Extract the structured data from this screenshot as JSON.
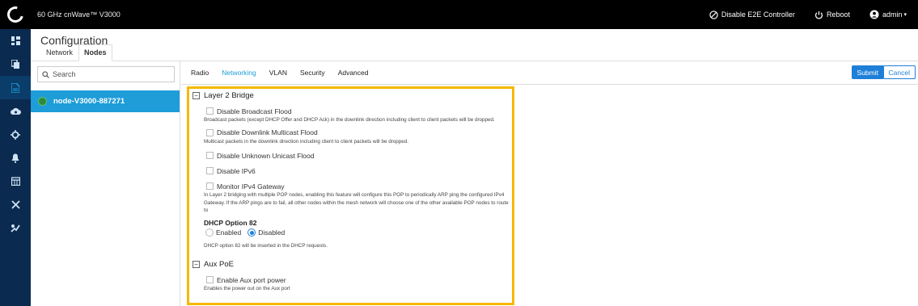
{
  "topbar": {
    "app_title": "60 GHz cnWave™ V3000",
    "disable_e2e": "Disable E2E Controller",
    "reboot": "Reboot",
    "user": "admin"
  },
  "rail": {
    "items": [
      "dashboard",
      "copy",
      "configuration",
      "cloud",
      "network",
      "alerts",
      "calendar",
      "tools",
      "maintenance"
    ],
    "active_index": 2
  },
  "page": {
    "title": "Configuration",
    "subtabs": [
      "Network",
      "Nodes"
    ],
    "active_subtab": "Nodes"
  },
  "nodelist": {
    "search_placeholder": "Search",
    "nodes": [
      "node-V3000-887271"
    ]
  },
  "tabs": {
    "items": [
      "Radio",
      "Networking",
      "VLAN",
      "Security",
      "Advanced"
    ],
    "active": "Networking",
    "submit": "Submit",
    "cancel": "Cancel"
  },
  "layer2": {
    "title": "Layer 2 Bridge",
    "collapse_symbol": "−",
    "broadcast_label": "Disable Broadcast Flood",
    "broadcast_desc": "Broadcast packets (except DHCP Offer and DHCP Ack) in the downlink direction including client to client packets will be dropped.",
    "multicast_label": "Disable Downlink Multicast Flood",
    "multicast_desc": "Multicast packets in the downlink direction including client to client packets will be dropped.",
    "unicast_label": "Disable Unknown Unicast Flood",
    "ipv6_label": "Disable IPv6",
    "gateway_label": "Monitor IPv4 Gateway",
    "gateway_desc": "In Layer 2 bridging with multiple POP nodes, enabling this feature will configure this POP to periodically ARP ping the configured IPv4 Gateway. If the ARP pings are to fail, all other nodes within the mesh network will choose one of the other available POP nodes to route to",
    "dhcp_title": "DHCP Option 82",
    "dhcp_enabled": "Enabled",
    "dhcp_disabled": "Disabled",
    "dhcp_selected": "Disabled",
    "dhcp_desc": "DHCP option 82 will be inserted in the DHCP requests."
  },
  "auxpoe": {
    "title": "Aux PoE",
    "collapse_symbol": "−",
    "enable_label": "Enable Aux port power",
    "enable_desc": "Enables the power out on the Aux port"
  },
  "colors": {
    "accent": "#1e9dd8",
    "highlight": "#f5b800",
    "rail": "#0a2a4f"
  }
}
